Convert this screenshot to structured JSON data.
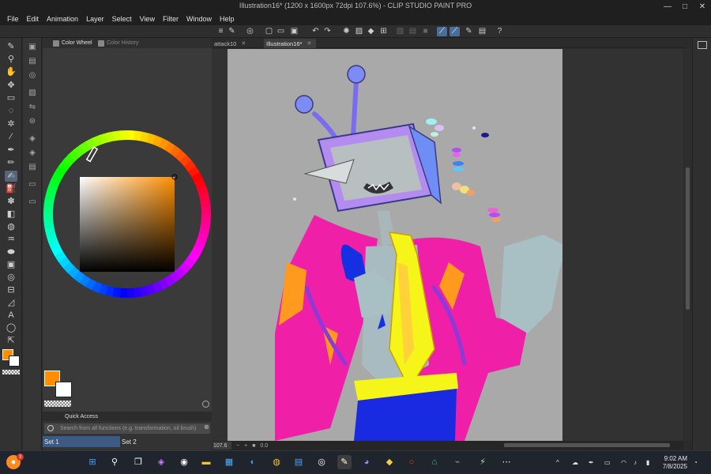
{
  "window": {
    "title": "Illustration16* (1200 x 1600px 72dpi 107.6%) - CLIP STUDIO PAINT PRO",
    "minimize_glyph": "—",
    "maximize_glyph": "□",
    "close_glyph": "✕"
  },
  "menu": [
    "File",
    "Edit",
    "Animation",
    "Layer",
    "Select",
    "View",
    "Filter",
    "Window",
    "Help"
  ],
  "color_panel": {
    "tabs": [
      {
        "label": "Color Wheel",
        "active": true
      },
      {
        "label": "Color History",
        "active": false
      }
    ],
    "main_color": "#ff8f00",
    "sub_color": "#ffffff",
    "rgb": {
      "r": "255",
      "g": "143",
      "b": "0"
    }
  },
  "quick_access": {
    "title": "Quick Access",
    "search_placeholder": "Search from all functions (e.g. transformation, oil brush)",
    "sets": [
      "Set 1",
      "Set 2"
    ]
  },
  "canvas_tabs": [
    {
      "label": "attack10",
      "active": false
    },
    {
      "label": "Illustration16*",
      "active": true
    }
  ],
  "status": {
    "zoom": "107.6",
    "rotation": "0.0"
  },
  "taskbar": {
    "notification_count": "3",
    "time": "9:02 AM",
    "date": "7/8/2025"
  }
}
